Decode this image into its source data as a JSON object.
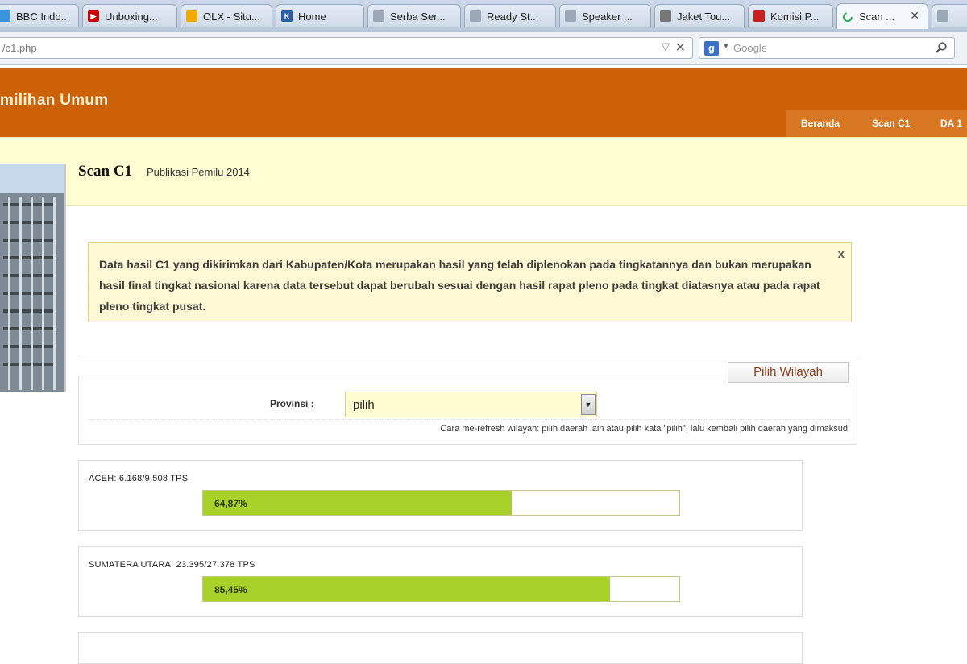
{
  "browser": {
    "tabs": [
      {
        "label": "BBC Indo...",
        "icon": "twitter-bird-icon",
        "color": "#3b94d9"
      },
      {
        "label": "Unboxing...",
        "icon": "youtube-icon",
        "color": "#cc0000"
      },
      {
        "label": "OLX - Situ...",
        "icon": "olx-logo-icon",
        "color": "#f2a900"
      },
      {
        "label": "Home",
        "icon": "k-logo-icon",
        "color": "#2a5ea8"
      },
      {
        "label": "Serba Ser...",
        "icon": "page-icon",
        "color": "#9aa8b8"
      },
      {
        "label": "Ready St...",
        "icon": "page-icon",
        "color": "#9aa8b8"
      },
      {
        "label": "Speaker ...",
        "icon": "page-icon",
        "color": "#9aa8b8"
      },
      {
        "label": "Jaket Tou...",
        "icon": "shopping-cart-icon",
        "color": "#777777"
      },
      {
        "label": "Komisi P...",
        "icon": "garuda-emblem-icon",
        "color": "#c81e1e"
      },
      {
        "label": "Scan ...",
        "icon": "loading-spinner-icon",
        "color": "#2eaa55",
        "active": true
      }
    ],
    "url": "/c1.php",
    "search_placeholder": "Google"
  },
  "site": {
    "title": "milihan Umum",
    "nav": [
      "Beranda",
      "Scan C1",
      "DA 1"
    ],
    "header_color": "#cd6108"
  },
  "page": {
    "title": "Scan C1",
    "subtitle": "Publikasi Pemilu 2014"
  },
  "notice": {
    "text": "Data hasil C1 yang dikirimkan dari Kabupaten/Kota merupakan hasil yang telah diplenokan pada tingkatannya dan bukan merupakan hasil final tingkat nasional karena data tersebut dapat berubah sesuai dengan hasil rapat pleno pada tingkat diatasnya atau pada rapat pleno tingkat pusat.",
    "close_label": "x"
  },
  "filter": {
    "button_label": "Pilih Wilayah",
    "province_label": "Provinsi :",
    "province_value": "pilih",
    "hint": "Cara me-refresh wilayah: pilih daerah lain atau pilih kata \"pilih\", lalu kembali pilih daerah yang dimaksud"
  },
  "progress": [
    {
      "label": "ACEH: 6.168/9.508 TPS",
      "percent_label": "64,87%",
      "percent": 64.87
    },
    {
      "label": "SUMATERA UTARA: 23.395/27.378 TPS",
      "percent_label": "85,45%",
      "percent": 85.45
    }
  ],
  "progress_color": "#a8d12a"
}
